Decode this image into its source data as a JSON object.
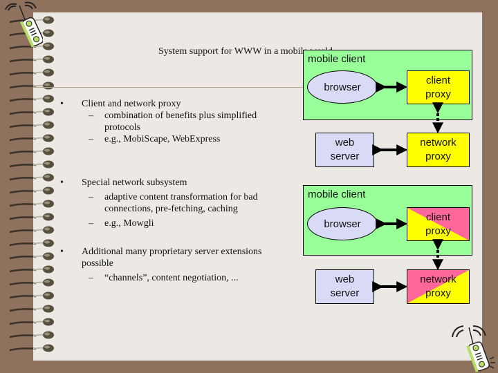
{
  "slide": {
    "title": "System support for WWW in a mobile world",
    "bullets": [
      {
        "text": "Client and network proxy",
        "subs": [
          "combination of benefits plus simplified protocols",
          "e.g., MobiScape, WebExpress"
        ]
      },
      {
        "text": "Special network subsystem",
        "subs": [
          "adaptive content transformation for bad connections, pre-fetching, caching",
          "e.g., Mowgli"
        ]
      },
      {
        "text": "Additional many proprietary server extensions possible",
        "subs": [
          "“channels”, content negotiation, ..."
        ]
      }
    ],
    "bullet_glyph": "•",
    "dash_glyph": "–"
  },
  "diagram_top": {
    "container_label": "mobile client",
    "browser": "browser",
    "client_proxy": [
      "client",
      "proxy"
    ],
    "web_server": [
      "web",
      "server"
    ],
    "network_proxy": [
      "network",
      "proxy"
    ]
  },
  "diagram_bottom": {
    "container_label": "mobile client",
    "browser": "browser",
    "client_proxy": [
      "client",
      "proxy"
    ],
    "web_server": [
      "web",
      "server"
    ],
    "network_proxy": [
      "network",
      "proxy"
    ]
  },
  "colors": {
    "background": "#8f725e",
    "paper": "#ece8e4",
    "mobile_client": "#99ff99",
    "proxy_yellow": "#ffff00",
    "proxy_pink": "#ff6699",
    "lavender": "#d9daf5"
  },
  "icons": {
    "top_left": "mobile-phone-icon",
    "bottom_right": "mobile-phone-icon",
    "binding": "spiral-binding"
  }
}
